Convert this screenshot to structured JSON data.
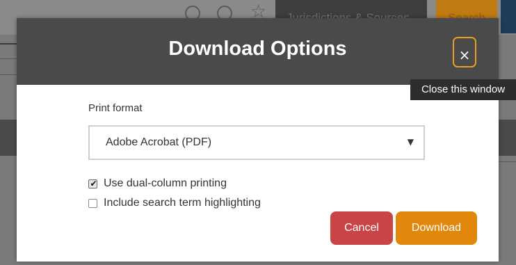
{
  "background": {
    "jurisdictions_label": "Jurisdictions & Sources",
    "search_label": "Search",
    "icons": [
      "history-icon",
      "add-alert-icon",
      "star-icon"
    ]
  },
  "modal": {
    "title": "Download Options",
    "close_icon": "×",
    "close_tooltip": "Close this window",
    "print_format_label": "Print format",
    "print_format_selected": "Adobe Acrobat (PDF)",
    "select_arrow": "▼",
    "options": [
      {
        "label": "Use dual-column printing",
        "checked": true
      },
      {
        "label": "Include search term highlighting",
        "checked": false
      }
    ],
    "check_mark": "✔",
    "cancel_label": "Cancel",
    "download_label": "Download"
  },
  "colors": {
    "header": "#4a4a4a",
    "accent": "#e0870c",
    "cancel": "#c94545",
    "focus_ring": "#e8a020"
  }
}
